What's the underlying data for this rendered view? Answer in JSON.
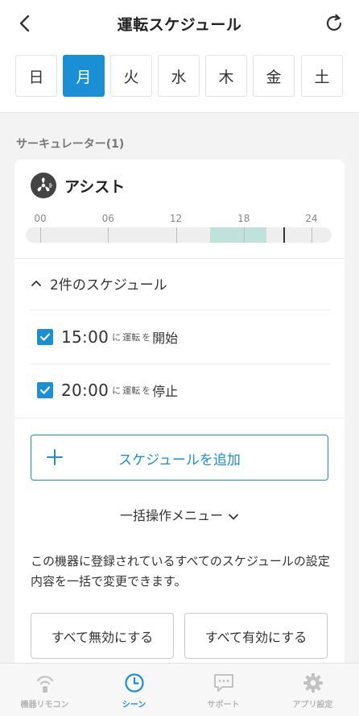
{
  "header": {
    "title": "運転スケジュール"
  },
  "days": [
    {
      "label": "日",
      "active": false
    },
    {
      "label": "月",
      "active": true
    },
    {
      "label": "火",
      "active": false
    },
    {
      "label": "水",
      "active": false
    },
    {
      "label": "木",
      "active": false
    },
    {
      "label": "金",
      "active": false
    },
    {
      "label": "土",
      "active": false
    }
  ],
  "section_label": "サーキュレーター(1)",
  "device": {
    "name": "アシスト",
    "icon": "circulator-fan-icon",
    "timeline": {
      "ticks": [
        "00",
        "06",
        "12",
        "18",
        "24"
      ],
      "run_start_hour": 15,
      "run_end_hour": 20,
      "current_hour": 21.5
    }
  },
  "schedules": {
    "header": "2件のスケジュール",
    "items": [
      {
        "time": "15:00",
        "connector": "に",
        "small": "運転",
        "particle": "を",
        "action": "開始",
        "checked": true
      },
      {
        "time": "20:00",
        "connector": "に",
        "small": "運転",
        "particle": "を",
        "action": "停止",
        "checked": true
      }
    ]
  },
  "add_button": "スケジュールを追加",
  "bulk_menu": "一括操作メニュー",
  "description": "この機器に登録されているすべてのスケジュールの設定内容を一括で変更できます。",
  "bulk_buttons": {
    "disable_all": "すべて無効にする",
    "enable_all": "すべて有効にする"
  },
  "tabs": [
    {
      "label": "機器リモコン",
      "icon": "remote-wave-icon",
      "active": false
    },
    {
      "label": "シーン",
      "icon": "clock-icon",
      "active": true
    },
    {
      "label": "サポート",
      "icon": "chat-bubble-icon",
      "active": false
    },
    {
      "label": "アプリ設定",
      "icon": "gear-icon",
      "active": false
    }
  ],
  "colors": {
    "accent": "#1a8fd6",
    "timeline_fill": "#bfe3dc"
  }
}
